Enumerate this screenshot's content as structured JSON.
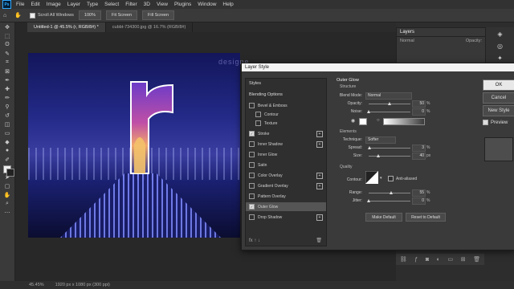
{
  "menubar": {
    "items": [
      "File",
      "Edit",
      "Image",
      "Layer",
      "Type",
      "Select",
      "Filter",
      "3D",
      "View",
      "Plugins",
      "Window",
      "Help"
    ],
    "app_logo": "Ps"
  },
  "options": {
    "scroll_all_windows": "Scroll All Windows",
    "zoom": "100%",
    "fit_screen": "Fit Screen",
    "fill_screen": "Fill Screen"
  },
  "tabs": [
    {
      "label": "Untitled-1 @ 45.5% (r, RGB/8#) *",
      "active": true
    },
    {
      "label": "cubbt-734300.jpg @ 16.7% (RGB/8#)",
      "active": false
    }
  ],
  "status": {
    "zoom": "45.45%",
    "doc": "1920 px x 1080 px (300 ppi)"
  },
  "canvas": {
    "letter": "r"
  },
  "watermark": "designe",
  "layers_panel": {
    "title": "Layers",
    "mode": "Normal",
    "opacity_label": "Opacity:"
  },
  "dialog": {
    "title": "Layer Style",
    "styles_header": "Styles",
    "blending_options": "Blending Options",
    "items": [
      {
        "label": "Bevel & Emboss",
        "checked": false,
        "plus": false,
        "sub": false
      },
      {
        "label": "Contour",
        "checked": false,
        "plus": false,
        "sub": true
      },
      {
        "label": "Texture",
        "checked": false,
        "plus": false,
        "sub": true
      },
      {
        "label": "Stroke",
        "checked": true,
        "plus": true,
        "sub": false
      },
      {
        "label": "Inner Shadow",
        "checked": false,
        "plus": true,
        "sub": false
      },
      {
        "label": "Inner Glow",
        "checked": false,
        "plus": false,
        "sub": false
      },
      {
        "label": "Satin",
        "checked": false,
        "plus": false,
        "sub": false
      },
      {
        "label": "Color Overlay",
        "checked": false,
        "plus": true,
        "sub": false
      },
      {
        "label": "Gradient Overlay",
        "checked": false,
        "plus": true,
        "sub": false
      },
      {
        "label": "Pattern Overlay",
        "checked": false,
        "plus": false,
        "sub": false
      },
      {
        "label": "Outer Glow",
        "checked": true,
        "plus": false,
        "sub": false,
        "active": true
      },
      {
        "label": "Drop Shadow",
        "checked": false,
        "plus": true,
        "sub": false
      }
    ],
    "footer_fx": "fx",
    "outer_glow": {
      "title": "Outer Glow",
      "structure": "Structure",
      "blend_mode_label": "Blend Mode:",
      "blend_mode": "Normal",
      "opacity_label": "Opacity:",
      "opacity": "50",
      "noise_label": "Noise:",
      "noise": "0",
      "percent": "%",
      "elements": "Elements",
      "technique_label": "Technique:",
      "technique": "Softer",
      "spread_label": "Spread:",
      "spread": "3",
      "size_label": "Size:",
      "size": "40",
      "px": "px",
      "quality": "Quality",
      "contour_label": "Contour:",
      "anti_aliased": "Anti-aliased",
      "range_label": "Range:",
      "range": "55",
      "jitter_label": "Jitter:",
      "jitter": "0",
      "make_default": "Make Default",
      "reset_default": "Reset to Default",
      "glow_color": "#ffffff"
    },
    "buttons": {
      "ok": "OK",
      "cancel": "Cancel",
      "new_style": "New Style",
      "preview": "Preview"
    }
  }
}
